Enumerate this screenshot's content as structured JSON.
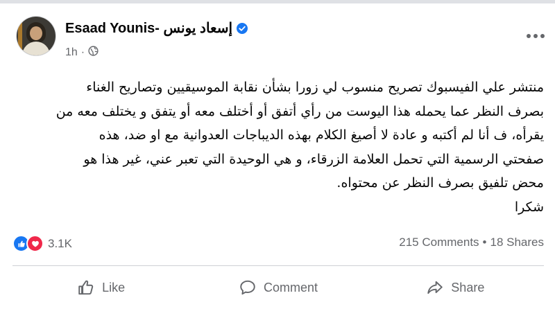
{
  "post": {
    "author": "Esaad Younis- إسعاد يونس",
    "time": "1h",
    "meta_separator": "·",
    "verified_icon": "verified-badge-icon",
    "privacy_icon": "globe-icon",
    "lines": [
      "منتشر علي الفيسبوك تصريح منسوب لي زورا بشأن نقابة الموسيقيين وتصاريح الغناء",
      "بصرف النظر عما يحمله هذا اليوست من رأي أتفق أو أختلف معه أو يتفق و يختلف معه من",
      "يقرأه، ف أنا لم أكتبه و عادة لا أصيغ الكلام بهذه الديباجات العدوانية مع او ضد، هذه",
      "صفحتي الرسمية التي تحمل العلامة الزرقاء، و هي الوحيدة التي تعبر عني، غير هذا هو",
      "محض تلفيق بصرف النظر عن محتواه.",
      "شكرا"
    ]
  },
  "stats": {
    "reactions_count": "3.1K",
    "comments": "215 Comments",
    "separator": "•",
    "shares": "18 Shares"
  },
  "actions": {
    "like": "Like",
    "comment": "Comment",
    "share": "Share"
  },
  "colors": {
    "facebook_blue": "#1877f2",
    "love_red": "#f0284a",
    "secondary_text": "#65676b"
  }
}
